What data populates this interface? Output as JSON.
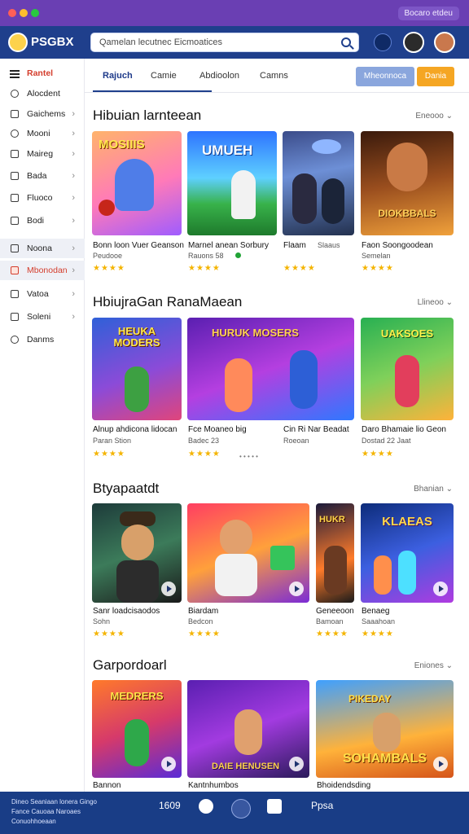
{
  "titlebar": {
    "chip": "Bocaro etdeu"
  },
  "header": {
    "brand": "PSGBX",
    "search_placeholder": "Qamelan lecutnec Eicmoatices"
  },
  "sidebar": [
    {
      "label": "Rantel",
      "icon": "menu-icon"
    },
    {
      "label": "Alocdent",
      "icon": "circle-icon"
    },
    {
      "label": "Gaichems",
      "icon": "home-icon"
    },
    {
      "label": "Mooni",
      "icon": "compass-icon"
    },
    {
      "label": "Maireg",
      "icon": "chart-icon"
    },
    {
      "label": "Bada",
      "icon": "list-icon"
    },
    {
      "label": "Fluoco",
      "icon": "square-icon"
    },
    {
      "label": "Bodi",
      "icon": "book-icon"
    },
    {
      "label": "Noona",
      "icon": "tag-icon"
    },
    {
      "label": "Mbonodan",
      "icon": "fire-icon"
    },
    {
      "label": "Vatoa",
      "icon": "video-icon"
    },
    {
      "label": "Soleni",
      "icon": "settings-icon"
    },
    {
      "label": "Danms",
      "icon": "info-icon"
    }
  ],
  "tabs": [
    {
      "label": "Rajuch",
      "active": true
    },
    {
      "label": "Camie",
      "active": false
    },
    {
      "label": "Abdioolon",
      "active": false
    },
    {
      "label": "Camns",
      "active": false
    }
  ],
  "buttons": {
    "primary": "Mheonnoca",
    "secondary": "Dania"
  },
  "sections": [
    {
      "title": "Hibuian larnteean",
      "more": "Eneooo",
      "cards": [
        {
          "title": "Bonn loon Vuer Geanson",
          "subtitle": "Peudooe",
          "stars": 4,
          "artwork": "MOSIIIS"
        },
        {
          "title": "Marnel anean Sorbury",
          "subtitle": "Rauons 58",
          "stars": 4,
          "artwork": "UMUEH"
        },
        {
          "title": "Flaam",
          "subtitle": "Slaaus",
          "stars": 4,
          "artwork": ""
        },
        {
          "title": "Faon Soongoodean",
          "subtitle": "Semelan",
          "stars": 4,
          "artwork": "DIOKBBALS"
        }
      ]
    },
    {
      "title": "HbiujraGan RanaMaean",
      "more": "Llineoo",
      "cards": [
        {
          "title": "Alnup ahdicona lidocan",
          "subtitle": "Paran Stion",
          "stars": 4,
          "artwork": "HEUKA MODERS"
        },
        {
          "title": "Fce Moaneo big",
          "subtitle": "Badec 23",
          "stars": 4,
          "artwork": "HURUK MOSERS"
        },
        {
          "title": "Cin Ri Nar Beadat",
          "subtitle": "Roeoan",
          "stars": 4,
          "artwork": ""
        },
        {
          "title": "Daro Bhamaie lio Geon",
          "subtitle": "Dostad 22 Jaat",
          "stars": 4,
          "artwork": "UAKSOES"
        }
      ]
    },
    {
      "title": "Btyapaatdt",
      "more": "Bhanian",
      "cards": [
        {
          "title": "Sanr loadcisaodos",
          "subtitle": "Sohn",
          "stars": 4,
          "artwork": ""
        },
        {
          "title": "Biardam",
          "subtitle": "Bedcon",
          "stars": 4,
          "artwork": ""
        },
        {
          "title": "Geneeoon",
          "subtitle": "Bamoan",
          "stars": 4,
          "artwork": "HUKR"
        },
        {
          "title": "Benaeg",
          "subtitle": "Saaahoan",
          "stars": 4,
          "artwork": "KLAEAS"
        }
      ]
    },
    {
      "title": "Garpordoarl",
      "more": "Eniones",
      "cards": [
        {
          "title": "Bannon",
          "subtitle": "",
          "stars": 0,
          "artwork": "MEDRERS"
        },
        {
          "title": "Kantnhumbos",
          "subtitle": "",
          "stars": 0,
          "artwork": "DAIE HENUSEN"
        },
        {
          "title": "Bhoidendsding",
          "subtitle": "",
          "stars": 0,
          "artwork": "SOHAMBALS"
        }
      ]
    }
  ],
  "bottom_bar": {
    "lines": [
      "Dineo Seaniaan lonera Gingo",
      "Fance Cauoaa Naroaes",
      "Conuohhoeaan"
    ],
    "num1": "1609",
    "label2": "Ppsa"
  }
}
